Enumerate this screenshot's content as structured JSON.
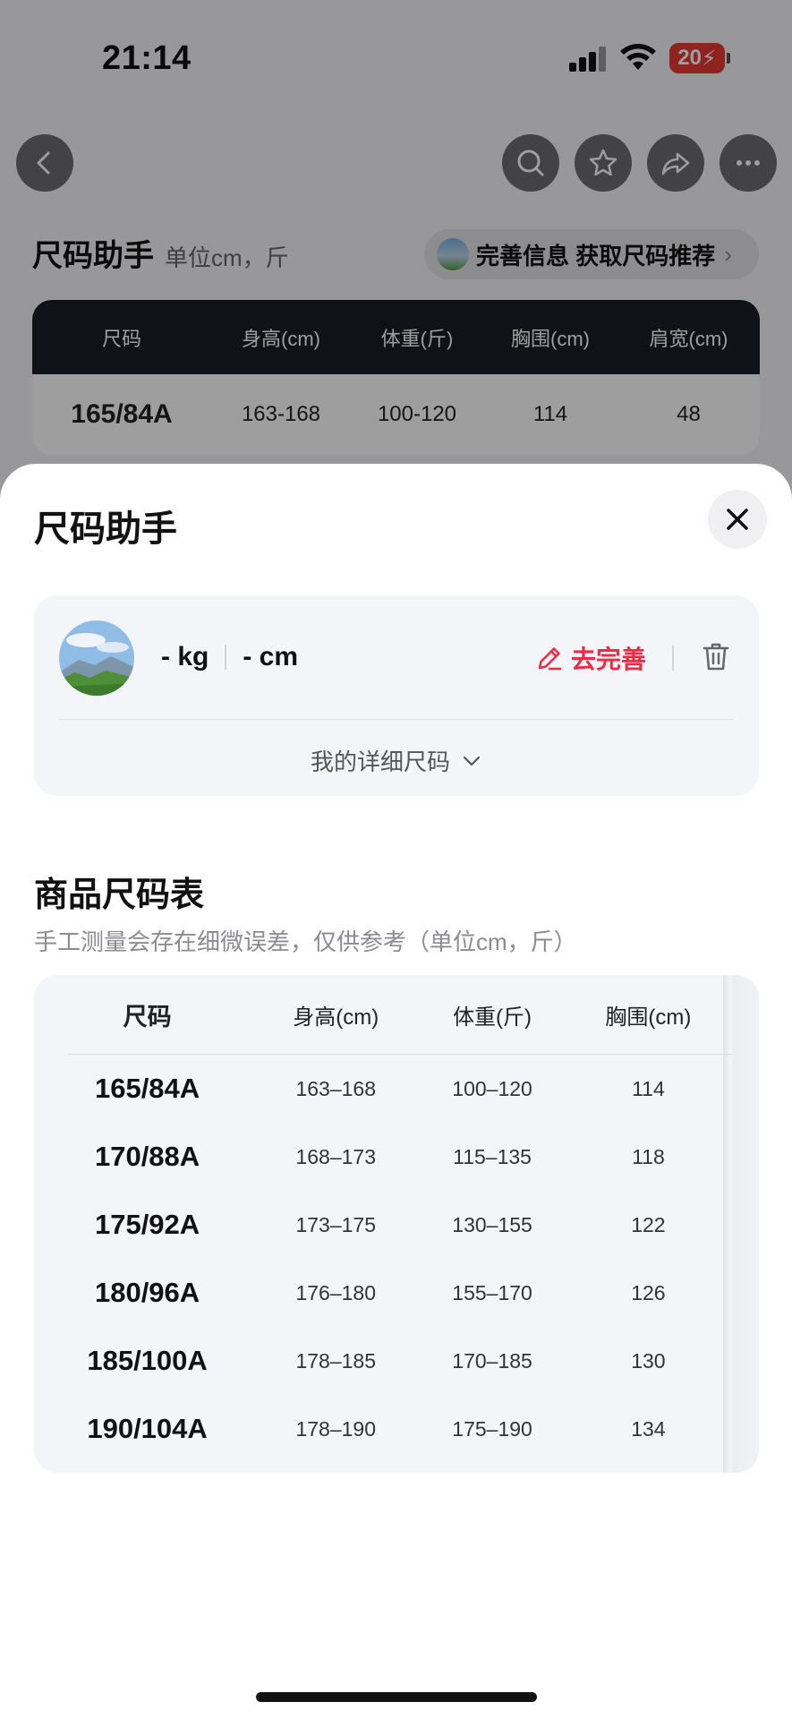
{
  "status_bar": {
    "time": "21:14",
    "battery": "20"
  },
  "background": {
    "title": "尺码助手",
    "unit": "单位cm，斤",
    "pill_text": "完善信息 获取尺码推荐",
    "table": {
      "headers": [
        "尺码",
        "身高(cm)",
        "体重(斤)",
        "胸围(cm)",
        "肩宽(cm)"
      ],
      "row": [
        "165/84A",
        "163-168",
        "100-120",
        "114",
        "48"
      ]
    }
  },
  "sheet": {
    "title": "尺码助手",
    "profile": {
      "weight": "- kg",
      "height": "- cm",
      "edit_label": "去完善",
      "detail_label": "我的详细尺码"
    },
    "size_table": {
      "title": "商品尺码表",
      "subtitle": "手工测量会存在细微误差，仅供参考（单位cm，斤）",
      "headers": [
        "尺码",
        "身高(cm)",
        "体重(斤)",
        "胸围(cm)"
      ],
      "rows": [
        [
          "165/84A",
          "163–168",
          "100–120",
          "114"
        ],
        [
          "170/88A",
          "168–173",
          "115–135",
          "118"
        ],
        [
          "175/92A",
          "173–175",
          "130–155",
          "122"
        ],
        [
          "180/96A",
          "176–180",
          "155–170",
          "126"
        ],
        [
          "185/100A",
          "178–185",
          "170–185",
          "130"
        ],
        [
          "190/104A",
          "178–190",
          "175–190",
          "134"
        ]
      ]
    }
  },
  "colors": {
    "accent": "#ee2b45",
    "table_header_bg": "#1b1d29",
    "card_bg": "#f4f5f9"
  },
  "icons": [
    "back-icon",
    "search-icon",
    "star-icon",
    "share-icon",
    "more-icon",
    "close-icon",
    "edit-icon",
    "trash-icon",
    "chevron-down-icon"
  ]
}
